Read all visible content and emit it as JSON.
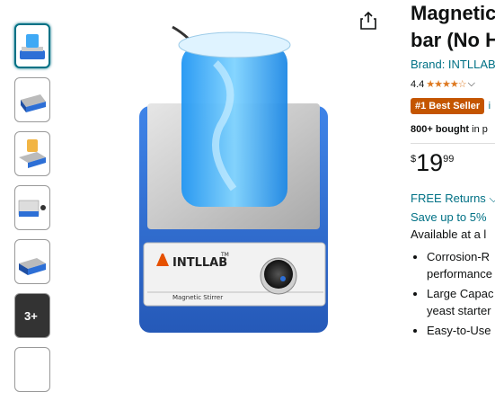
{
  "product": {
    "title_line1": "Magnetic",
    "title_line2": "bar (No H",
    "brand": "Brand: INTLLAB",
    "rating": "4.4",
    "stars": "★★★★☆",
    "badge": "#1 Best Seller",
    "badge_after": "i",
    "bought_bold": "800+ bought",
    "bought_rest": " in p",
    "price_currency": "$",
    "price_whole": "19",
    "price_fraction": "99",
    "returns": "FREE Returns",
    "save": "Save up to 5%",
    "availability": "Available at a l",
    "bullets": [
      {
        "line1": "Corrosion-R",
        "line2": "performance"
      },
      {
        "line1": "Large Capac",
        "line2": "yeast starter"
      },
      {
        "line1": "Easy-to-Use",
        "line2": ""
      }
    ]
  },
  "device": {
    "brand_label": "INTLLAB",
    "tm": "TM",
    "label": "Magnetic Stirrer"
  },
  "thumbnails": {
    "more_label": "3+"
  },
  "colors": {
    "link": "#007185",
    "badge": "#c45500",
    "star": "#de7921",
    "device_blue": "#2d6fd6"
  }
}
